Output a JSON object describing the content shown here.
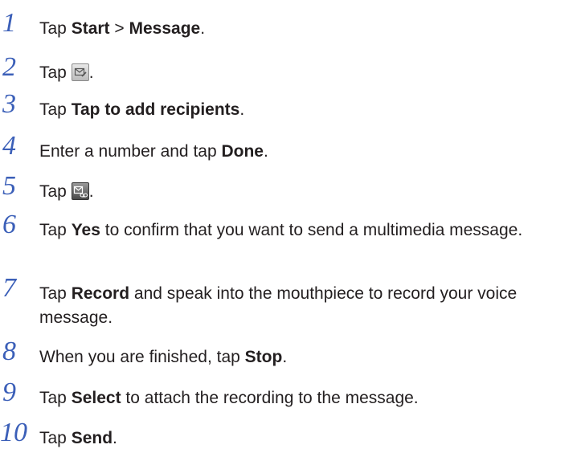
{
  "steps": [
    {
      "number": "1",
      "parts": [
        "Tap ",
        "Start",
        " > ",
        "Message",
        "."
      ]
    },
    {
      "number": "2",
      "before": "Tap ",
      "icon": "compose-message-icon",
      "after": "."
    },
    {
      "number": "3",
      "parts": [
        "Tap ",
        "Tap to add recipients",
        "."
      ]
    },
    {
      "number": "4",
      "parts": [
        "Enter a number and tap ",
        "Done",
        "."
      ]
    },
    {
      "number": "5",
      "before": "Tap ",
      "icon": "voice-message-icon",
      "after": "."
    },
    {
      "number": "6",
      "parts": [
        "Tap ",
        "Yes",
        " to confirm that you want to send a multimedia message."
      ]
    },
    {
      "number": "7",
      "parts": [
        "Tap ",
        "Record",
        " and speak into the mouthpiece to record your voice message."
      ]
    },
    {
      "number": "8",
      "parts": [
        "When you are finished, tap ",
        "Stop",
        "."
      ]
    },
    {
      "number": "9",
      "parts": [
        "Tap ",
        "Select",
        " to attach the recording to the message."
      ]
    },
    {
      "number": "10",
      "parts": [
        "Tap ",
        "Send",
        "."
      ]
    }
  ],
  "colors": {
    "step_number": "#3b5fb8",
    "body_text": "#231f20"
  }
}
